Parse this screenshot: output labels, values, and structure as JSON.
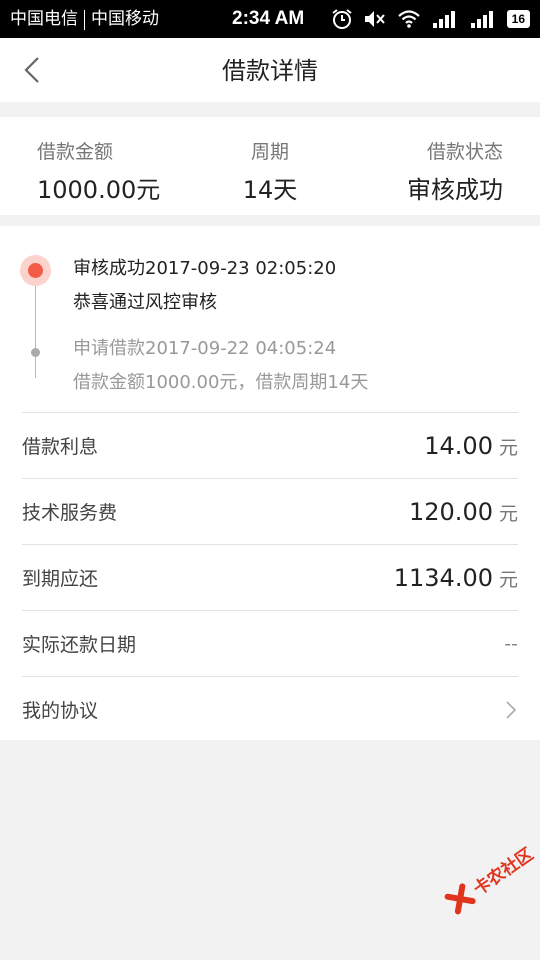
{
  "status_bar": {
    "carrier1": "中国电信",
    "carrier2": "中国移动",
    "time": "2:34 AM",
    "battery": "16"
  },
  "nav": {
    "title": "借款详情"
  },
  "summary": {
    "amount_label": "借款金额",
    "amount_value": "1000.00元",
    "period_label": "周期",
    "period_value": "14天",
    "status_label": "借款状态",
    "status_value": "审核成功"
  },
  "timeline": [
    {
      "title": "审核成功2017-09-23 02:05:20",
      "desc": "恭喜通过风控审核",
      "active": true
    },
    {
      "title": "申请借款2017-09-22 04:05:24",
      "desc": "借款金额1000.00元，借款周期14天",
      "active": false
    }
  ],
  "rows": {
    "interest_label": "借款利息",
    "interest_value": "14.00",
    "service_label": "技术服务费",
    "service_value": "120.00",
    "due_label": "到期应还",
    "due_value": "1134.00",
    "unit": "元",
    "actual_label": "实际还款日期",
    "actual_value": "--",
    "agreement_label": "我的协议"
  },
  "watermark": {
    "text": "卡农社区"
  },
  "colors": {
    "accent": "#f35b46",
    "background": "#f2f2f2",
    "watermark": "#e1341e"
  }
}
